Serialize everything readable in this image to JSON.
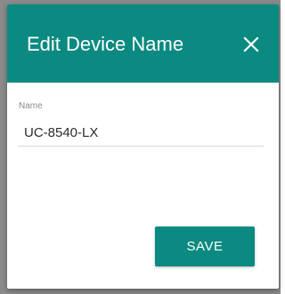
{
  "dialog": {
    "title": "Edit Device Name",
    "close_icon": "close-icon"
  },
  "form": {
    "name_label": "Name",
    "name_value": "UC-8540-LX"
  },
  "actions": {
    "save_label": "SAVE"
  },
  "colors": {
    "accent": "#0a8a80",
    "backdrop": "#8a8a8a"
  }
}
